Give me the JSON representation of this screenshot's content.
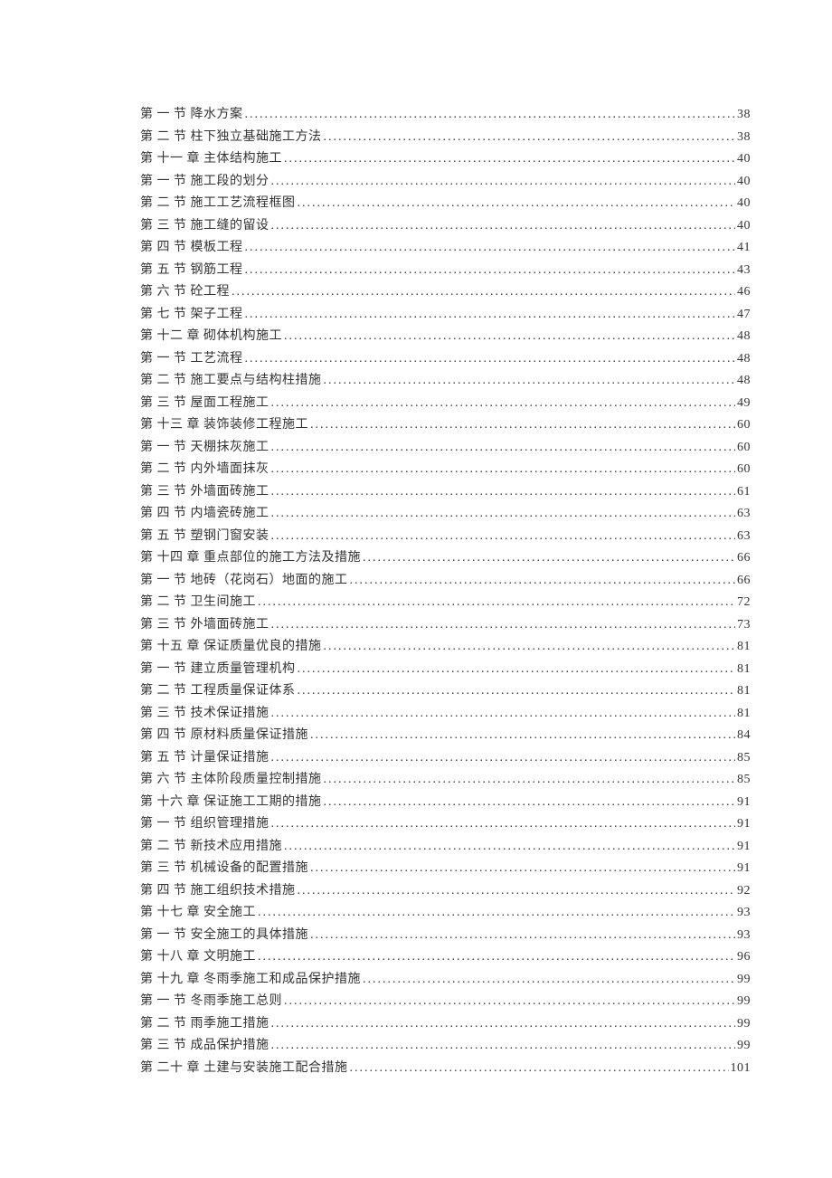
{
  "toc": [
    {
      "label": "第 一 节 降水方案",
      "page": "38"
    },
    {
      "label": "第 二 节 柱下独立基础施工方法",
      "page": "38"
    },
    {
      "label": "第 十一 章 主体结构施工",
      "page": "40"
    },
    {
      "label": "第 一 节 施工段的划分",
      "page": "40"
    },
    {
      "label": "第 二 节 施工工艺流程框图",
      "page": "40"
    },
    {
      "label": "第 三 节 施工缝的留设",
      "page": "40"
    },
    {
      "label": "第 四 节 模板工程",
      "page": "41"
    },
    {
      "label": "第 五 节 钢筋工程",
      "page": "43"
    },
    {
      "label": "第 六 节 砼工程",
      "page": "46"
    },
    {
      "label": "第 七 节 架子工程",
      "page": "47"
    },
    {
      "label": "第 十二 章 砌体机构施工",
      "page": "48"
    },
    {
      "label": "第 一 节 工艺流程",
      "page": "48"
    },
    {
      "label": "第 二 节 施工要点与结构柱措施",
      "page": "48"
    },
    {
      "label": "第 三 节 屋面工程施工",
      "page": "49"
    },
    {
      "label": "第 十三 章  装饰装修工程施工",
      "page": "60"
    },
    {
      "label": "第 一 节 天棚抹灰施工",
      "page": "60"
    },
    {
      "label": "第 二 节 内外墙面抹灰",
      "page": "60"
    },
    {
      "label": "第 三 节 外墙面砖施工",
      "page": "61"
    },
    {
      "label": "第 四 节 内墙瓷砖施工",
      "page": "63"
    },
    {
      "label": "第 五 节 塑钢门窗安装",
      "page": "63"
    },
    {
      "label": "第 十四 章 重点部位的施工方法及措施",
      "page": "66"
    },
    {
      "label": "第 一 节 地砖（花岗石）地面的施工",
      "page": "66"
    },
    {
      "label": "第 二 节 卫生间施工",
      "page": "72"
    },
    {
      "label": "第 三 节 外墙面砖施工",
      "page": "73"
    },
    {
      "label": "第 十五 章 保证质量优良的措施",
      "page": "81"
    },
    {
      "label": "第 一 节 建立质量管理机构",
      "page": "81"
    },
    {
      "label": "第 二 节 工程质量保证体系",
      "page": "81"
    },
    {
      "label": "第 三 节 技术保证措施",
      "page": "81"
    },
    {
      "label": "第 四 节 原材料质量保证措施",
      "page": "84"
    },
    {
      "label": "第 五 节 计量保证措施",
      "page": "85"
    },
    {
      "label": "第 六 节 主体阶段质量控制措施",
      "page": "85"
    },
    {
      "label": "第 十六 章 保证施工工期的措施",
      "page": "91"
    },
    {
      "label": "第 一 节 组织管理措施",
      "page": "91"
    },
    {
      "label": "第 二 节 新技术应用措施",
      "page": "91"
    },
    {
      "label": "第 三 节 机械设备的配置措施",
      "page": "91"
    },
    {
      "label": "第 四 节 施工组织技术措施",
      "page": "92"
    },
    {
      "label": "第 十七 章 安全施工",
      "page": "93"
    },
    {
      "label": "第 一 节 安全施工的具体措施",
      "page": "93"
    },
    {
      "label": "第 十八 章 文明施工",
      "page": "96"
    },
    {
      "label": "第 十九 章 冬雨季施工和成品保护措施",
      "page": "99"
    },
    {
      "label": "第 一 节 冬雨季施工总则",
      "page": "99"
    },
    {
      "label": "第 二 节 雨季施工措施",
      "page": "99"
    },
    {
      "label": "第 三 节 成品保护措施",
      "page": "99"
    },
    {
      "label": "第 二十 章 土建与安装施工配合措施",
      "page": "101"
    }
  ]
}
